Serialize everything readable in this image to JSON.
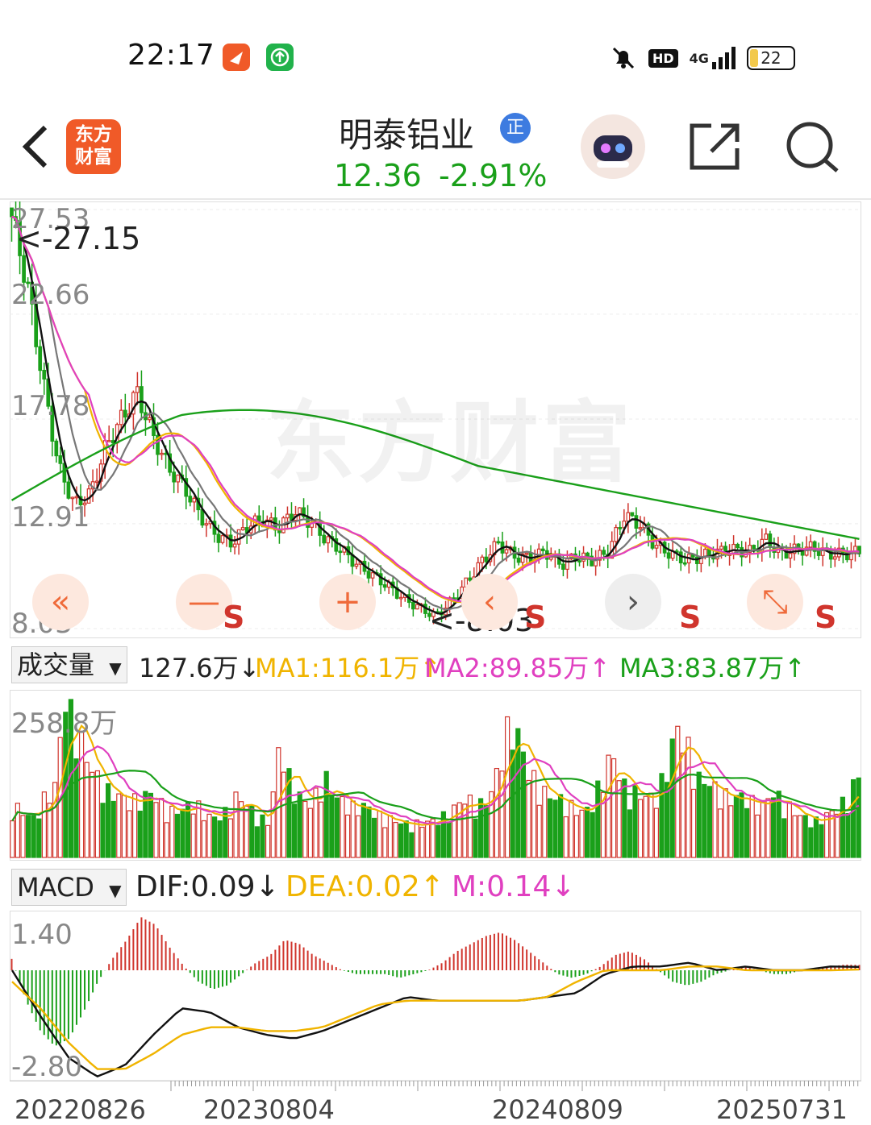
{
  "status_bar": {
    "time": "22:17",
    "network": "4G",
    "battery": "22"
  },
  "header": {
    "back_icon": "chevron-left-icon",
    "app_logo_text": "东方\n财富",
    "stock_name": "明泰铝业",
    "badge": "正",
    "price": "12.36",
    "change_pct": "-2.91%",
    "icons": [
      "robot-assistant-icon",
      "share-icon",
      "search-icon"
    ]
  },
  "watermark": "东方财富",
  "price_panel": {
    "y_ticks": [
      "27.53",
      "22.66",
      "17.78",
      "12.91",
      "8.03"
    ],
    "high_annotation": "<-27.15",
    "low_annotation": "<-8.03",
    "controls": [
      "«",
      "—",
      "+",
      "‹",
      "›",
      "⤡"
    ],
    "signals": [
      "S",
      "S",
      "S",
      "S"
    ]
  },
  "volume_panel": {
    "selector": "成交量",
    "value": "127.6万↓",
    "ma1": "MA1:116.1万↑",
    "ma2": "MA2:89.85万↑",
    "ma3": "MA3:83.87万↑",
    "max_label": "258.8万"
  },
  "macd_panel": {
    "selector": "MACD",
    "dif": "DIF:0.09↓",
    "dea": "DEA:0.02↑",
    "m": "M:0.14↓",
    "y_ticks": [
      "1.40",
      "-2.80"
    ]
  },
  "x_axis": {
    "dates": [
      "20220826",
      "20230804",
      "20240809",
      "20250731"
    ]
  },
  "colors": {
    "up": "#d0352d",
    "down": "#1aa01a",
    "ma1": "#f0b400",
    "ma2": "#e040c0",
    "ma3": "#1aa01a",
    "price_ma_long": "#1aa01a"
  },
  "chart_data": [
    {
      "type": "candlestick",
      "title": "明泰铝业",
      "ylim": [
        8.03,
        27.53
      ],
      "y_ticks": [
        27.53,
        22.66,
        17.78,
        12.91,
        8.03
      ],
      "x_range": [
        "20220826",
        "20250731"
      ],
      "annotations": [
        {
          "text": "<-27.15",
          "value": 27.15
        },
        {
          "text": "<-8.03",
          "value": 8.03
        }
      ],
      "close_path": [
        27.2,
        24.0,
        19.5,
        15.5,
        13.8,
        14.3,
        16.5,
        17.8,
        19.0,
        17.0,
        15.5,
        14.6,
        13.3,
        12.4,
        12.0,
        12.8,
        13.1,
        12.7,
        13.5,
        13.0,
        12.2,
        11.7,
        11.0,
        10.5,
        10.0,
        9.4,
        9.0,
        8.6,
        9.3,
        10.2,
        11.2,
        12.0,
        11.4,
        11.3,
        11.6,
        11.0,
        11.4,
        11.2,
        11.6,
        13.3,
        12.9,
        11.9,
        11.5,
        11.2,
        11.4,
        11.6,
        11.7,
        11.6,
        12.2,
        11.5,
        11.7,
        11.8,
        11.5,
        11.5,
        11.6
      ]
    },
    {
      "type": "bar",
      "title": "成交量",
      "ylim": [
        0,
        258.8
      ],
      "unit": "万",
      "series": [
        {
          "name": "MA1",
          "value": 116.1
        },
        {
          "name": "MA2",
          "value": 89.85
        },
        {
          "name": "MA3",
          "value": 83.87
        }
      ],
      "last_value": 127.6,
      "values": [
        80,
        70,
        60,
        90,
        110,
        258,
        200,
        150,
        120,
        100,
        95,
        85,
        90,
        100,
        80,
        70,
        75,
        85,
        65,
        60,
        70,
        95,
        80,
        60,
        55,
        180,
        110,
        90,
        80,
        130,
        95,
        85,
        75,
        80,
        65,
        60,
        55,
        50,
        52,
        55,
        60,
        70,
        90,
        85,
        80,
        110,
        190,
        200,
        140,
        110,
        95,
        90,
        80,
        70,
        75,
        120,
        160,
        110,
        100,
        95,
        90,
        130,
        200,
        170,
        120,
        115,
        100,
        90,
        95,
        85,
        80,
        100,
        85,
        70,
        60,
        55,
        65,
        75,
        90,
        127.6
      ]
    },
    {
      "type": "bar",
      "title": "MACD",
      "ylim": [
        -2.8,
        1.4
      ],
      "series": [
        {
          "name": "DIF",
          "value": 0.09
        },
        {
          "name": "DEA",
          "value": 0.02
        },
        {
          "name": "M",
          "value": 0.14
        }
      ],
      "m_values": [
        0.3,
        -0.8,
        -1.6,
        -2.0,
        -1.8,
        -1.1,
        -0.3,
        0.3,
        0.8,
        1.4,
        1.2,
        0.6,
        0.1,
        -0.3,
        -0.5,
        -0.4,
        -0.1,
        0.2,
        0.4,
        0.8,
        0.7,
        0.4,
        0.2,
        0.0,
        -0.1,
        -0.1,
        -0.1,
        -0.2,
        -0.1,
        0.0,
        0.2,
        0.5,
        0.7,
        0.9,
        1.0,
        0.8,
        0.5,
        0.2,
        -0.1,
        -0.2,
        -0.1,
        0.1,
        0.4,
        0.5,
        0.3,
        0.0,
        -0.3,
        -0.4,
        -0.3,
        -0.1,
        0.0,
        0.1,
        0.0,
        -0.1,
        -0.1,
        0.0,
        0.05,
        0.1,
        0.15,
        0.14
      ],
      "dif_path": [
        0.0,
        -1.2,
        -2.3,
        -2.8,
        -2.5,
        -1.7,
        -1.0,
        -1.1,
        -1.5,
        -1.7,
        -1.8,
        -1.6,
        -1.3,
        -1.0,
        -0.7,
        -0.8,
        -0.8,
        -0.8,
        -0.8,
        -0.7,
        -0.6,
        -0.1,
        0.1,
        0.1,
        0.2,
        0.0,
        0.1,
        0.0,
        0.0,
        0.1,
        0.09
      ],
      "dea_path": [
        -0.3,
        -1.0,
        -1.9,
        -2.6,
        -2.6,
        -2.2,
        -1.7,
        -1.5,
        -1.5,
        -1.6,
        -1.6,
        -1.5,
        -1.2,
        -0.9,
        -0.8,
        -0.8,
        -0.8,
        -0.8,
        -0.8,
        -0.7,
        -0.3,
        0.0,
        0.0,
        0.0,
        0.1,
        0.1,
        0.0,
        0.0,
        0.0,
        0.0,
        0.02
      ]
    }
  ]
}
